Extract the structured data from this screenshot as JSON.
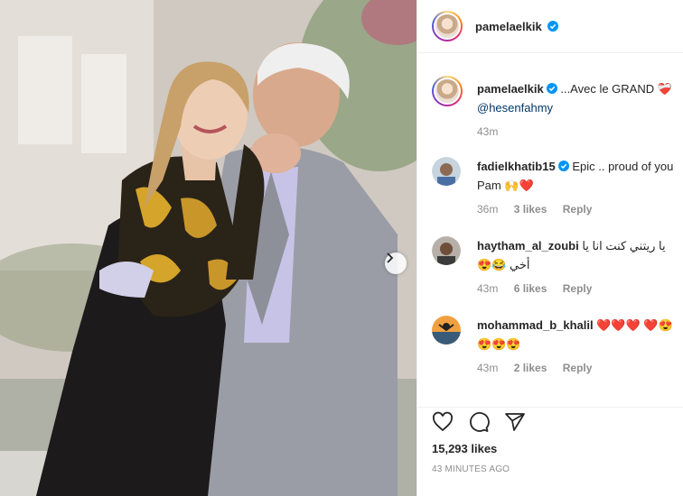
{
  "post": {
    "username": "pamelaelkik",
    "photo_alt": "Woman and older man embracing outdoors",
    "carousel_icon": "chevron-right-icon"
  },
  "caption": {
    "username": "pamelaelkik",
    "text": "...Avec le GRAND",
    "emoji": "❤️‍🩹",
    "mention": "@hesenfahmy",
    "time": "43m"
  },
  "comments": [
    {
      "username": "fadielkhatib15",
      "verified": true,
      "text": "Epic .. proud of you Pam 🙌❤️",
      "time": "36m",
      "likes": "3 likes",
      "reply": "Reply"
    },
    {
      "username": "haytham_al_zoubi",
      "verified": false,
      "text": "يا ريتني كنت انا يا أخي 😂😍",
      "time": "43m",
      "likes": "6 likes",
      "reply": "Reply"
    },
    {
      "username": "mohammad_b_khalil",
      "verified": false,
      "text": "❤️❤️❤️ ❤️😍😍😍😍",
      "time": "43m",
      "likes": "2 likes",
      "reply": "Reply"
    }
  ],
  "actions": {
    "like_icon": "heart-icon",
    "comment_icon": "comment-icon",
    "share_icon": "share-icon",
    "likes_count": "15,293 likes",
    "timestamp": "43 MINUTES AGO"
  },
  "colors": {
    "verified": "#0095f6",
    "link": "#00376b",
    "muted": "#8e8e8e"
  }
}
